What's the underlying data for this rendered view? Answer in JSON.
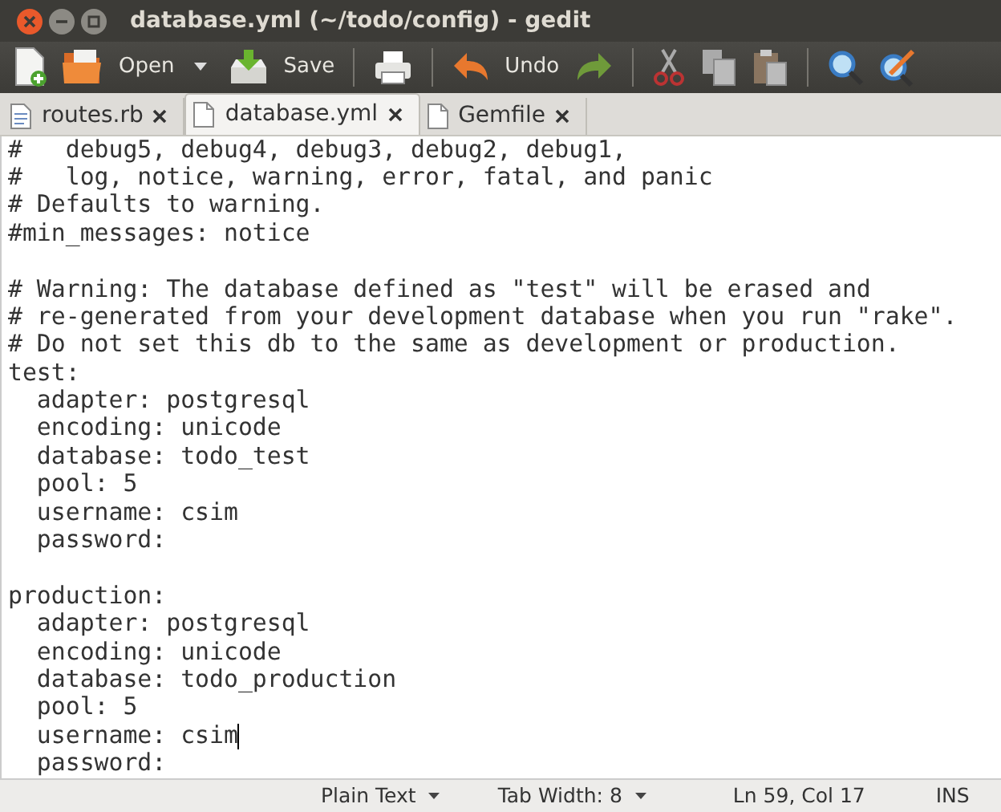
{
  "window": {
    "title": "database.yml (~/todo/config) - gedit"
  },
  "toolbar": {
    "open": "Open",
    "save": "Save",
    "undo": "Undo"
  },
  "tabs": [
    {
      "label": "routes.rb",
      "selected": false,
      "kind": "ruby"
    },
    {
      "label": "database.yml",
      "selected": true,
      "kind": "text"
    },
    {
      "label": "Gemfile",
      "selected": false,
      "kind": "text"
    }
  ],
  "editor": {
    "lines": [
      {
        "text": "#   debug5, debug4, debug3, debug2, debug1,",
        "cursor": false
      },
      {
        "text": "#   log, notice, warning, error, fatal, and panic",
        "cursor": false
      },
      {
        "text": "# Defaults to warning.",
        "cursor": false
      },
      {
        "text": "#min_messages: notice",
        "cursor": false
      },
      {
        "cursor": false
      },
      {
        "text": "# Warning: The database defined as \"test\" will be erased and",
        "cursor": false
      },
      {
        "text": "# re-generated from your development database when you run \"rake\".",
        "cursor": false
      },
      {
        "text": "# Do not set this db to the same as development or production.",
        "cursor": false
      },
      {
        "text": "test:",
        "cursor": false
      },
      {
        "text": "  adapter: postgresql",
        "cursor": false
      },
      {
        "text": "  encoding: unicode",
        "cursor": false
      },
      {
        "text": "  database: todo_test",
        "cursor": false
      },
      {
        "text": "  pool: 5",
        "cursor": false
      },
      {
        "text": "  username: csim",
        "cursor": false
      },
      {
        "text": "  password:",
        "cursor": false
      },
      {
        "cursor": false
      },
      {
        "text": "production:",
        "cursor": false
      },
      {
        "text": "  adapter: postgresql",
        "cursor": false
      },
      {
        "text": "  encoding: unicode",
        "cursor": false
      },
      {
        "text": "  database: todo_production",
        "cursor": false
      },
      {
        "text": "  pool: 5",
        "cursor": false
      },
      {
        "text": "  username: csim",
        "cursor": true
      },
      {
        "text": "  password:",
        "cursor": false
      }
    ]
  },
  "status_bar": {
    "language": "Plain Text",
    "tab_width": "Tab Width:  8",
    "position": "Ln 59, Col 17",
    "mode": "INS"
  }
}
